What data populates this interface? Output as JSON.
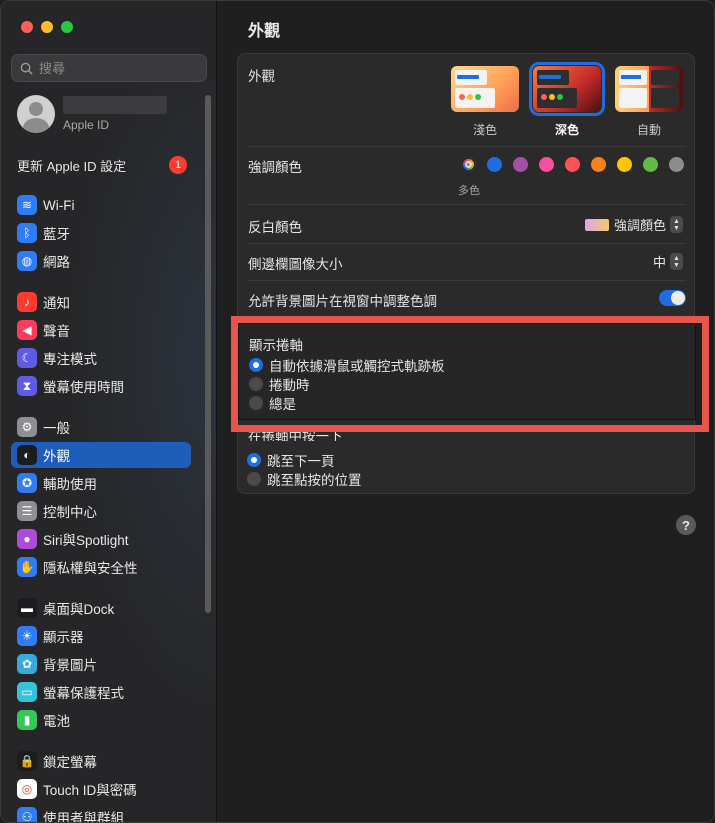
{
  "window": {
    "title": "外觀"
  },
  "sidebar": {
    "search_placeholder": "搜尋",
    "apple_id_label": "Apple ID",
    "update_label": "更新 Apple ID 設定",
    "update_badge": "1",
    "items": [
      {
        "label": "Wi-Fi",
        "icon": "wifi-icon",
        "color": "#2f7cf6"
      },
      {
        "label": "藍牙",
        "icon": "bluetooth-icon",
        "color": "#2f7cf6"
      },
      {
        "label": "網路",
        "icon": "globe-icon",
        "color": "#2f7cf6"
      },
      {
        "label": "通知",
        "icon": "bell-icon",
        "color": "#ff3b30"
      },
      {
        "label": "聲音",
        "icon": "speaker-icon",
        "color": "#ff3b5c"
      },
      {
        "label": "專注模式",
        "icon": "moon-icon",
        "color": "#5e5ce6"
      },
      {
        "label": "螢幕使用時間",
        "icon": "hourglass-icon",
        "color": "#5e5ce6"
      },
      {
        "label": "一般",
        "icon": "gear-icon",
        "color": "#8e8e93"
      },
      {
        "label": "外觀",
        "icon": "appearance-icon",
        "color": "#1c1c1e"
      },
      {
        "label": "輔助使用",
        "icon": "accessibility-icon",
        "color": "#2f7cf6"
      },
      {
        "label": "控制中心",
        "icon": "control-center-icon",
        "color": "#8e8e93"
      },
      {
        "label": "Siri與Spotlight",
        "icon": "siri-icon",
        "color": "#b04ad8"
      },
      {
        "label": "隱私權與安全性",
        "icon": "hand-icon",
        "color": "#2f7cf6"
      },
      {
        "label": "桌面與Dock",
        "icon": "dock-icon",
        "color": "#1c1c1e"
      },
      {
        "label": "顯示器",
        "icon": "sun-icon",
        "color": "#2f7cf6"
      },
      {
        "label": "背景圖片",
        "icon": "flower-icon",
        "color": "#35aadc"
      },
      {
        "label": "螢幕保護程式",
        "icon": "screensaver-icon",
        "color": "#35c3d9"
      },
      {
        "label": "電池",
        "icon": "battery-icon",
        "color": "#34c759"
      },
      {
        "label": "鎖定螢幕",
        "icon": "lock-icon",
        "color": "#1c1c1e"
      },
      {
        "label": "Touch ID與密碼",
        "icon": "fingerprint-icon",
        "color": "#ffffff"
      },
      {
        "label": "使用者與群組",
        "icon": "users-icon",
        "color": "#2f7cf6"
      }
    ]
  },
  "main": {
    "title": "外觀",
    "appearance_label": "外觀",
    "appearance_options": [
      "淺色",
      "深色",
      "自動"
    ],
    "accent_label": "強調顏色",
    "accent_selected_caption": "多色",
    "accent_colors": [
      "#ffffff",
      "#1f6de0",
      "#a550a7",
      "#f74f9e",
      "#ff5257",
      "#f7821b",
      "#ffc600",
      "#62ba46",
      "#8c8c8c"
    ],
    "highlight_label": "反白顏色",
    "highlight_value": "強調顏色",
    "sidebar_icon_label": "側邊欄圖像大小",
    "sidebar_icon_value": "中",
    "tint_label": "允許背景圖片在視窗中調整色調",
    "scrollbar_label": "顯示捲軸",
    "scrollbar_options": [
      "自動依據滑鼠或觸控式軌跡板",
      "捲動時",
      "總是"
    ],
    "click_label": "在捲軸中按一下",
    "click_options": [
      "跳至下一頁",
      "跳至點按的位置"
    ],
    "help": "?"
  }
}
